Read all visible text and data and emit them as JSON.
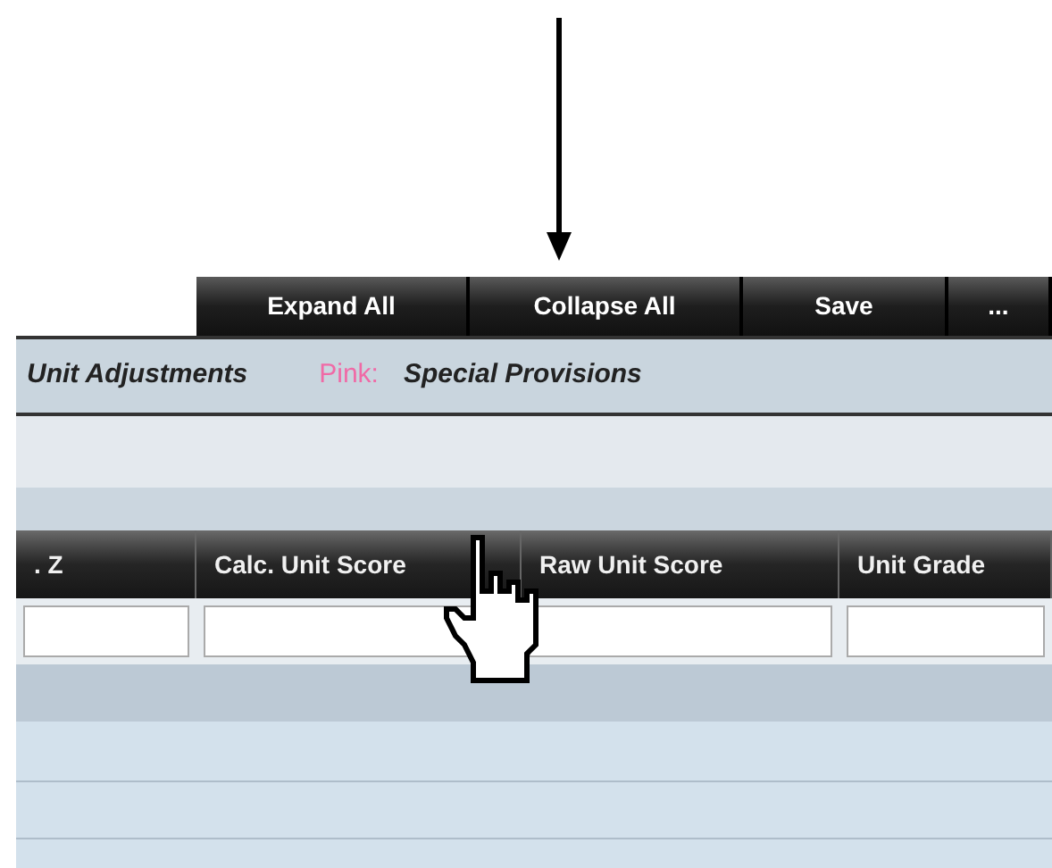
{
  "toolbar": {
    "buttons": [
      {
        "label": "Expand All"
      },
      {
        "label": "Collapse All"
      },
      {
        "label": "Save"
      },
      {
        "label": "..."
      }
    ]
  },
  "legend": [
    {
      "text": "Unit Adjustments"
    },
    {
      "key": "Pink:",
      "color": "#f06aa6",
      "text": "Special Provisions"
    }
  ],
  "table": {
    "columns": [
      {
        "label": ". Z"
      },
      {
        "label": "Calc. Unit Score"
      },
      {
        "label": "Raw Unit Score"
      },
      {
        "label": "Unit Grade"
      }
    ]
  }
}
